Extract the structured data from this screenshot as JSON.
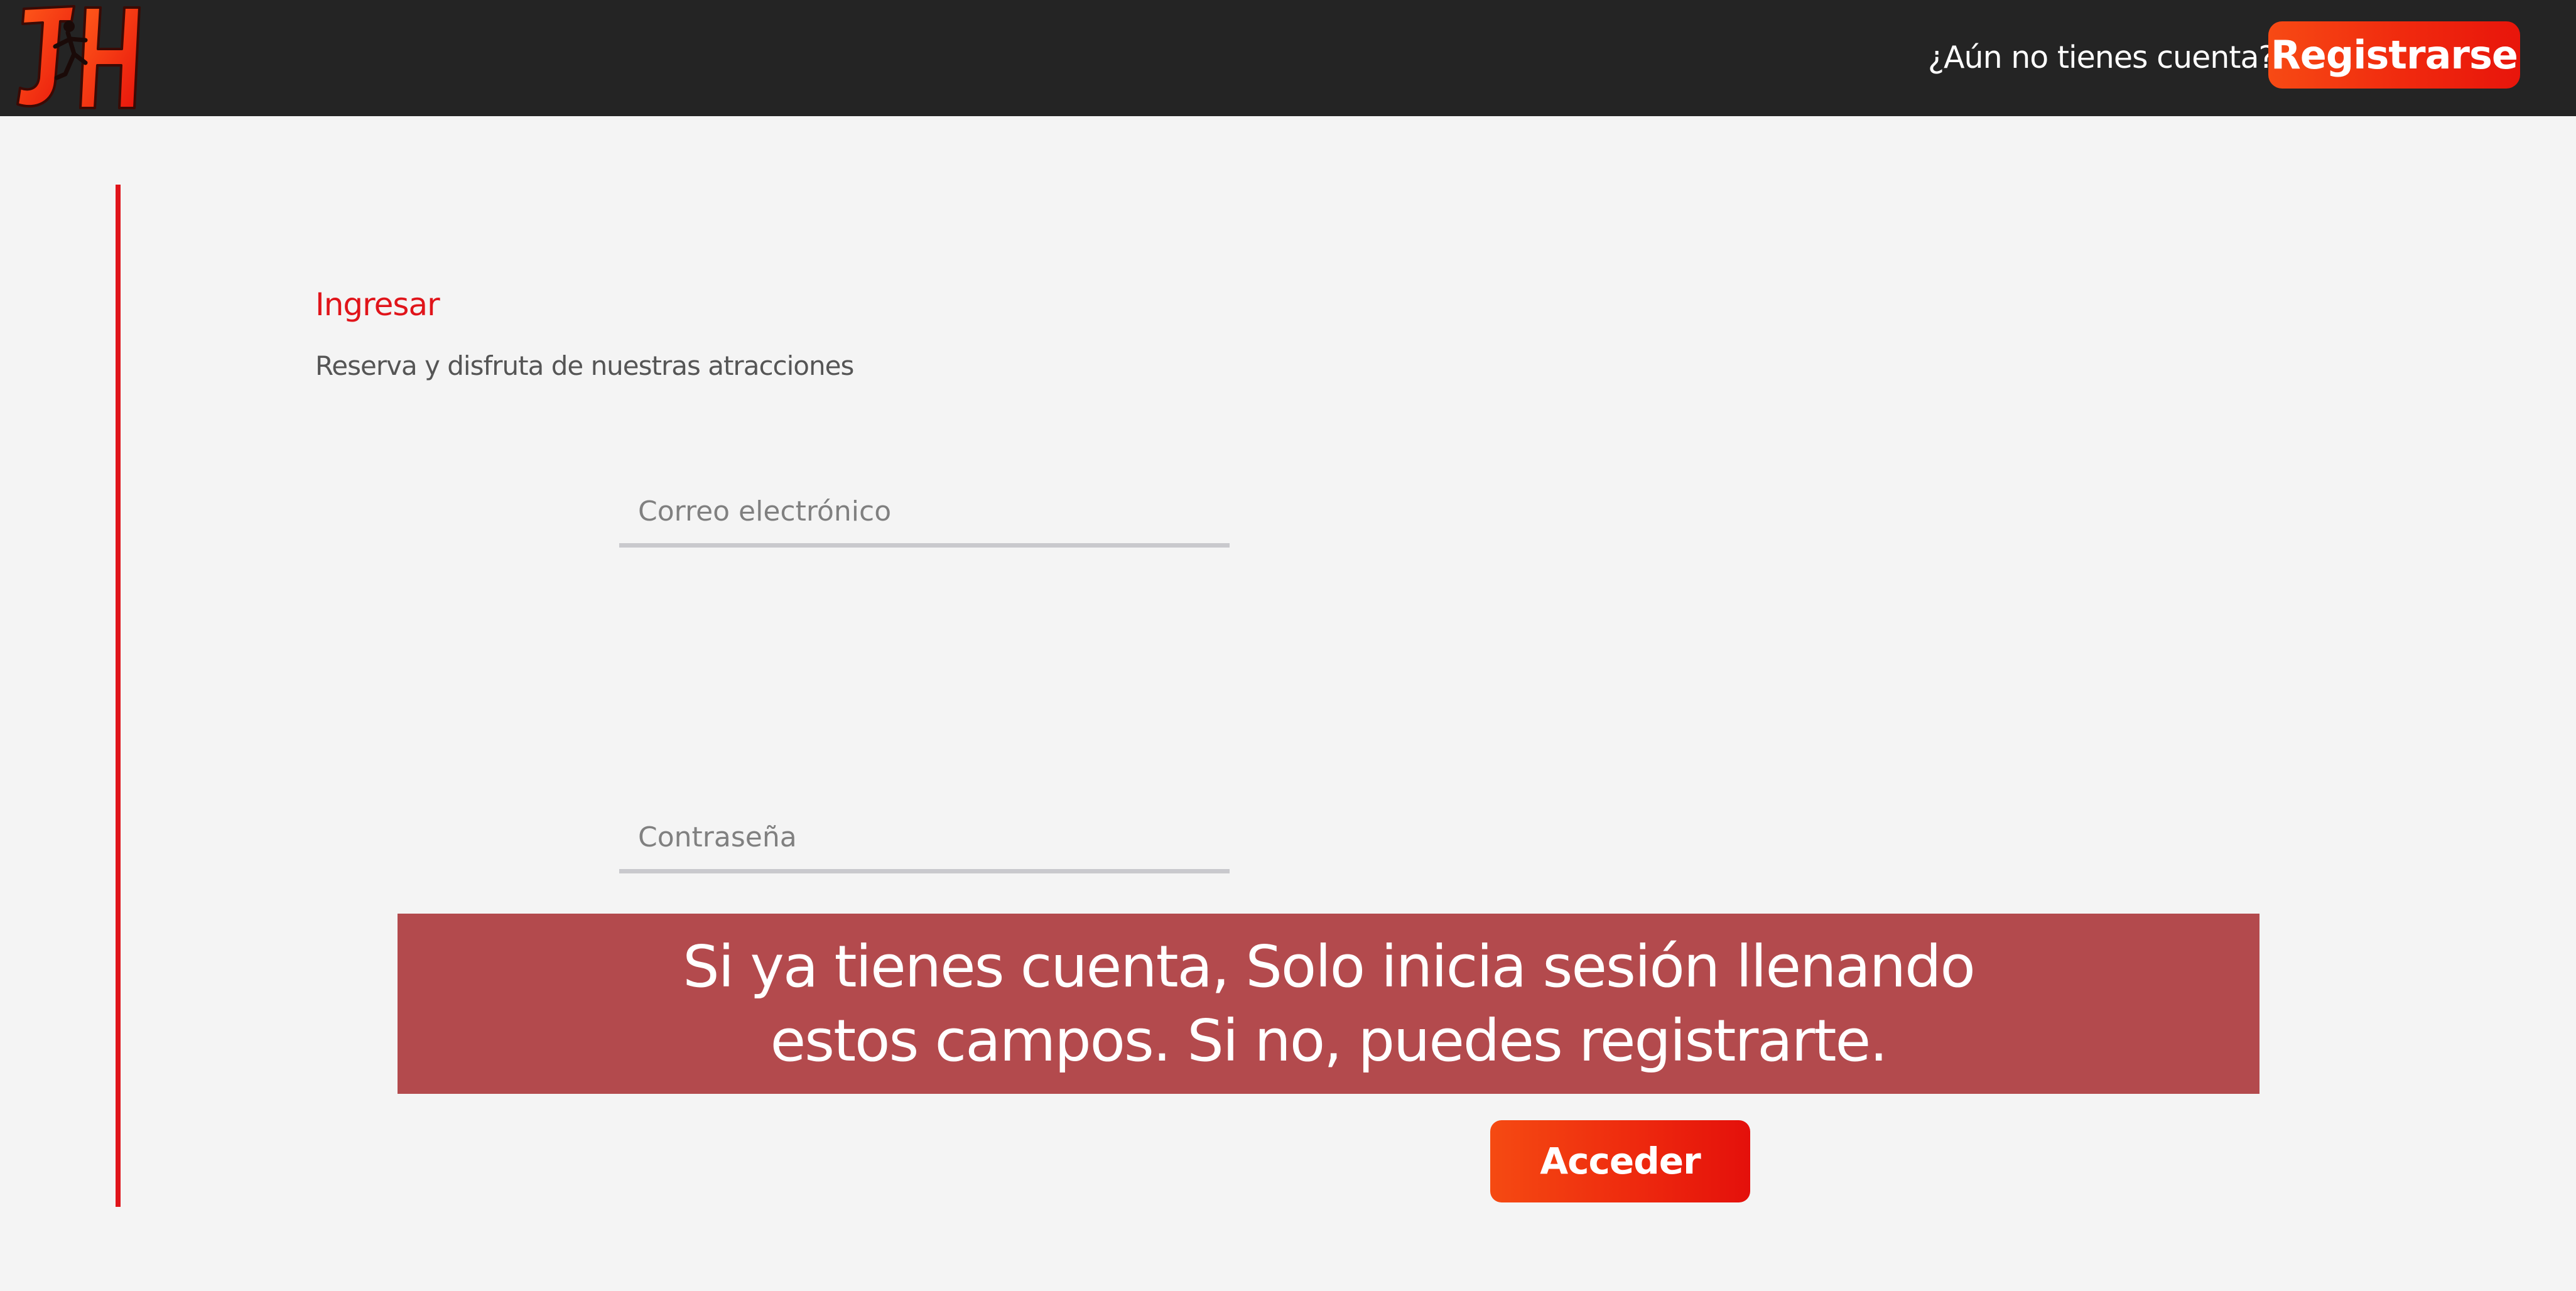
{
  "header": {
    "logo_text": "JH",
    "no_account_text": "¿Aún no tienes cuenta?",
    "register_label": "Registrarse"
  },
  "form": {
    "title": "Ingresar",
    "subtitle": "Reserva y disfruta de nuestras atracciones",
    "email_placeholder": "Correo electrónico",
    "password_placeholder": "Contraseña",
    "submit_label": "Acceder"
  },
  "tooltip": {
    "text": "Si ya tienes cuenta, Solo inicia sesión llenando estos campos. Si no, puedes registrarte."
  },
  "colors": {
    "header_bg": "#242424",
    "page_bg": "#f4f4f4",
    "accent_red": "#e0141a",
    "button_orange": "#f74a14",
    "tooltip_bg": "#b34a4d"
  }
}
